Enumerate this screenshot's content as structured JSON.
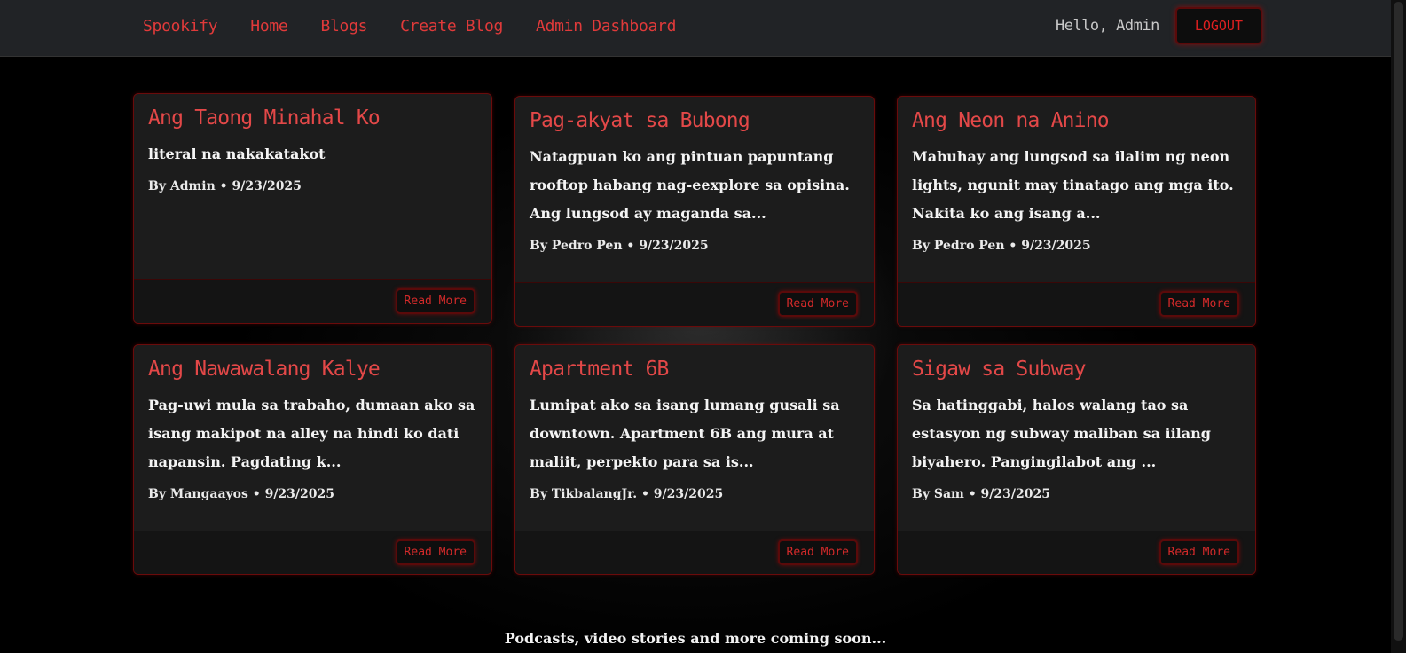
{
  "nav": {
    "brand": "Spookify",
    "links": [
      "Home",
      "Blogs",
      "Create Blog",
      "Admin Dashboard"
    ],
    "greeting": "Hello, Admin",
    "logout_label": "LOGOUT"
  },
  "posts": [
    {
      "title": "Ang Taong Minahal Ko",
      "excerpt": "literal na nakakatakot",
      "meta": "By Admin • 9/23/2025",
      "read_more": "Read More"
    },
    {
      "title": "Pag-akyat sa Bubong",
      "excerpt": "Natagpuan ko ang pintuan papuntang rooftop habang nag-eexplore sa opisina. Ang lungsod ay maganda sa...",
      "meta": "By Pedro Pen • 9/23/2025",
      "read_more": "Read More"
    },
    {
      "title": "Ang Neon na Anino",
      "excerpt": "Mabuhay ang lungsod sa ilalim ng neon lights, ngunit may tinatago ang mga ito. Nakita ko ang isang a...",
      "meta": "By Pedro Pen • 9/23/2025",
      "read_more": "Read More"
    },
    {
      "title": "Ang Nawawalang Kalye",
      "excerpt": "Pag-uwi mula sa trabaho, dumaan ako sa isang makipot na alley na hindi ko dati napansin. Pagdating k...",
      "meta": "By Mangaayos • 9/23/2025",
      "read_more": "Read More"
    },
    {
      "title": "Apartment 6B",
      "excerpt": "Lumipat ako sa isang lumang gusali sa downtown. Apartment 6B ang mura at maliit, perpekto para sa is...",
      "meta": "By TikbalangJr. • 9/23/2025",
      "read_more": "Read More"
    },
    {
      "title": "Sigaw sa Subway",
      "excerpt": "Sa hatinggabi, halos walang tao sa estasyon ng subway maliban sa iilang biyahero. Pangingilabot ang ...",
      "meta": "By Sam • 9/23/2025",
      "read_more": "Read More"
    }
  ],
  "footer": {
    "note": "Podcasts, video stories and more coming soon..."
  },
  "colors": {
    "accent": "#e03a3a",
    "card_bg": "#1c1c1c",
    "nav_bg": "#212326",
    "border": "#6a0b0b"
  }
}
